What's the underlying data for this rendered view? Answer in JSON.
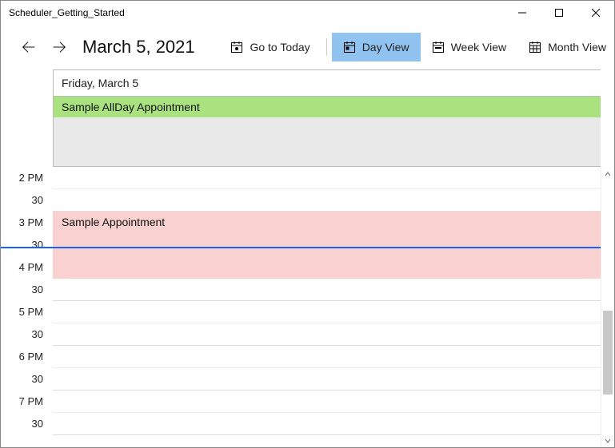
{
  "window": {
    "title": "Scheduler_Getting_Started"
  },
  "toolbar": {
    "date_title": "March 5, 2021",
    "today_label": "Go to Today",
    "day_label": "Day View",
    "week_label": "Week View",
    "month_label": "Month View"
  },
  "day": {
    "header": "Friday, March 5",
    "allday_appt": "Sample AllDay Appointment"
  },
  "appointment": {
    "title": "Sample Appointment"
  },
  "time_labels": [
    "2 PM",
    "30",
    "3 PM",
    "30",
    "4 PM",
    "30",
    "5 PM",
    "30",
    "6 PM",
    "30",
    "7 PM",
    "30"
  ],
  "colors": {
    "active_view": "#90c3f0",
    "allday_appt_bg": "#a9e27f",
    "appt_bg": "#f8d1d0",
    "now_line": "#1a5fff"
  }
}
